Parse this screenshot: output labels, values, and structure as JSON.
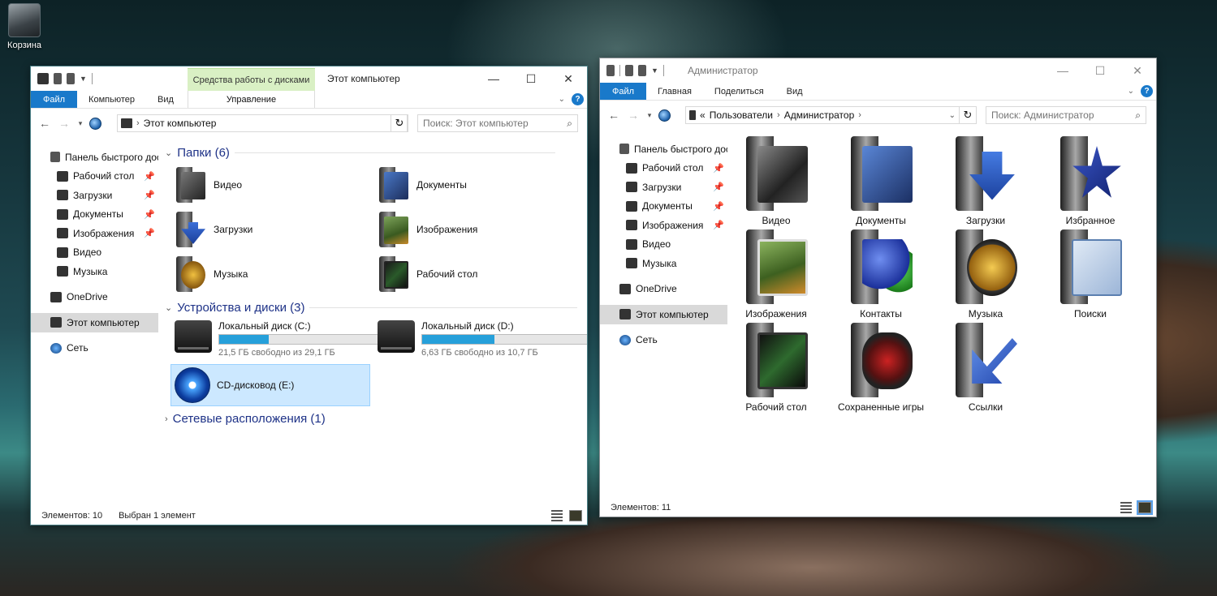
{
  "desktop": {
    "recycle_bin_label": "Корзина"
  },
  "window1": {
    "title": "Этот компьютер",
    "context_tab_group": "Средства работы с дисками",
    "ribbon": {
      "file": "Файл",
      "tabs": [
        "Компьютер",
        "Вид"
      ],
      "context_tab": "Управление"
    },
    "address": {
      "crumb": "Этот компьютер"
    },
    "search_placeholder": "Поиск: Этот компьютер",
    "nav": [
      {
        "label": "Панель быстрого доступа",
        "pinned": false
      },
      {
        "label": "Рабочий стол",
        "pinned": true
      },
      {
        "label": "Загрузки",
        "pinned": true
      },
      {
        "label": "Документы",
        "pinned": true
      },
      {
        "label": "Изображения",
        "pinned": true
      },
      {
        "label": "Видео",
        "pinned": false
      },
      {
        "label": "Музыка",
        "pinned": false
      },
      {
        "label": "OneDrive",
        "pinned": false
      },
      {
        "label": "Этот компьютер",
        "pinned": false
      },
      {
        "label": "Сеть",
        "pinned": false
      }
    ],
    "groups": {
      "folders": "Папки (6)",
      "devices": "Устройства и диски (3)",
      "network": "Сетевые расположения (1)"
    },
    "folders": [
      "Видео",
      "Документы",
      "Загрузки",
      "Изображения",
      "Музыка",
      "Рабочий стол"
    ],
    "drives": [
      {
        "name": "Локальный диск (C:)",
        "free": "21,5 ГБ свободно из 29,1 ГБ",
        "used_fraction": 0.26
      },
      {
        "name": "Локальный диск (D:)",
        "free": "6,63 ГБ свободно из 10,7 ГБ",
        "used_fraction": 0.38
      }
    ],
    "cd": {
      "name": "CD-дисковод (E:)"
    },
    "status": {
      "count": "Элементов: 10",
      "selected": "Выбран 1 элемент"
    }
  },
  "window2": {
    "title": "Администратор",
    "ribbon": {
      "file": "Файл",
      "tabs": [
        "Главная",
        "Поделиться",
        "Вид"
      ]
    },
    "address": {
      "prefix": "«",
      "crumbs": [
        "Пользователи",
        "Администратор"
      ]
    },
    "search_placeholder": "Поиск: Администратор",
    "nav": [
      {
        "label": "Панель быстрого доступа",
        "pinned": false
      },
      {
        "label": "Рабочий стол",
        "pinned": true
      },
      {
        "label": "Загрузки",
        "pinned": true
      },
      {
        "label": "Документы",
        "pinned": true
      },
      {
        "label": "Изображения",
        "pinned": true
      },
      {
        "label": "Видео",
        "pinned": false
      },
      {
        "label": "Музыка",
        "pinned": false
      },
      {
        "label": "OneDrive",
        "pinned": false
      },
      {
        "label": "Этот компьютер",
        "pinned": false
      },
      {
        "label": "Сеть",
        "pinned": false
      }
    ],
    "items": [
      "Видео",
      "Документы",
      "Загрузки",
      "Избранное",
      "Изображения",
      "Контакты",
      "Музыка",
      "Поиски",
      "Рабочий стол",
      "Сохраненные игры",
      "Ссылки"
    ],
    "status": {
      "count": "Элементов: 11"
    }
  },
  "colors": {
    "accent": "#1979ca",
    "selection": "#cce8ff",
    "drive_bar": "#26a0da",
    "context_tab": "#d9f0c4"
  }
}
